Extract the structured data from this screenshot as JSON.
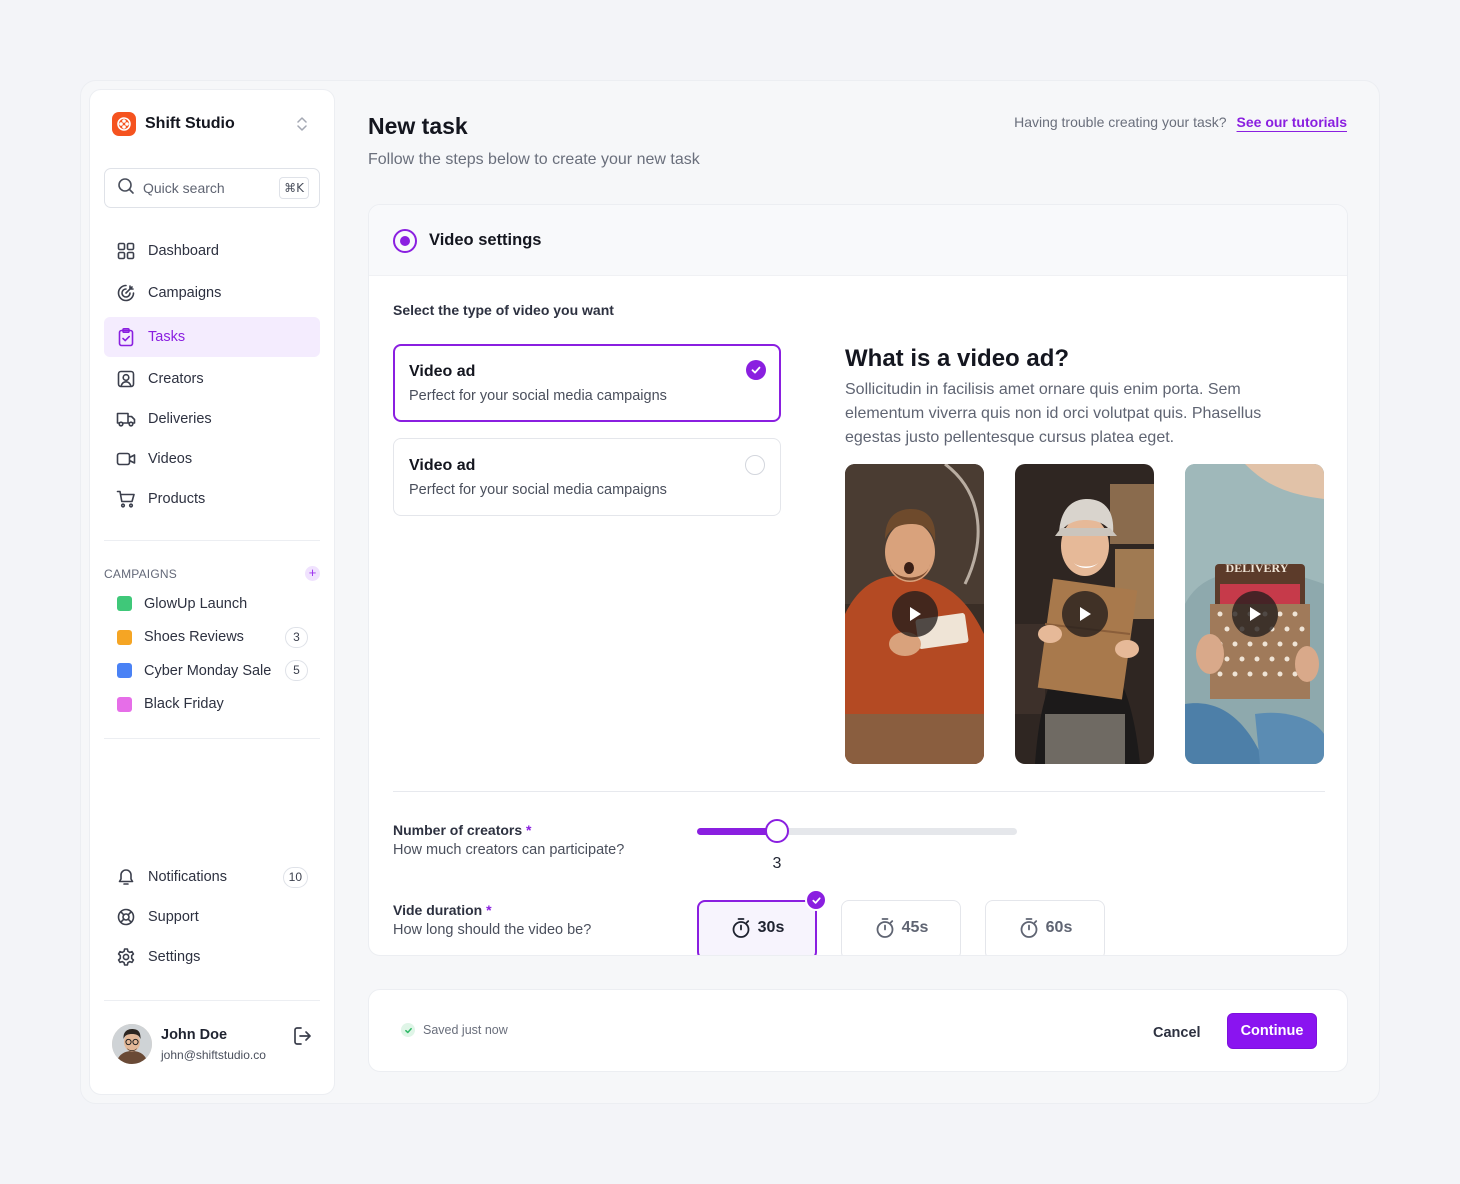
{
  "sidebar": {
    "brand": "Shift Studio",
    "search": {
      "placeholder": "Quick search",
      "shortcut": "⌘K"
    },
    "nav": [
      {
        "label": "Dashboard",
        "icon": "grid-icon"
      },
      {
        "label": "Campaigns",
        "icon": "target-icon"
      },
      {
        "label": "Tasks",
        "icon": "clipboard-check-icon",
        "active": true
      },
      {
        "label": "Creators",
        "icon": "user-square-icon"
      },
      {
        "label": "Deliveries",
        "icon": "truck-icon"
      },
      {
        "label": "Videos",
        "icon": "video-icon"
      },
      {
        "label": "Products",
        "icon": "cart-icon"
      }
    ],
    "campaigns_title": "CAMPAIGNS",
    "campaigns": [
      {
        "name": "GlowUp Launch",
        "color": "#3fc879",
        "count": null
      },
      {
        "name": "Shoes Reviews",
        "color": "#f5a524",
        "count": "3"
      },
      {
        "name": "Cyber Monday Sale",
        "color": "#4a82f5",
        "count": "5"
      },
      {
        "name": "Black Friday",
        "color": "#e66ee8",
        "count": null
      }
    ],
    "bottom_nav": [
      {
        "label": "Notifications",
        "icon": "bell-icon",
        "count": "10"
      },
      {
        "label": "Support",
        "icon": "lifebuoy-icon"
      },
      {
        "label": "Settings",
        "icon": "gear-icon"
      }
    ],
    "user": {
      "name": "John Doe",
      "email": "john@shiftstudio.co"
    }
  },
  "header": {
    "title": "New task",
    "subtitle": "Follow the steps below to create your new task",
    "help_text": "Having trouble creating your task?",
    "help_link": "See our tutorials"
  },
  "video_settings": {
    "title": "Video settings",
    "select_label": "Select the type of video you want",
    "options": [
      {
        "title": "Video ad",
        "description": "Perfect for your social media campaigns",
        "selected": true
      },
      {
        "title": "Video ad",
        "description": "Perfect for your social media campaigns",
        "selected": false
      }
    ],
    "info_title": "What is a video ad?",
    "info_text": "Sollicitudin in facilisis amet ornare quis enim porta. Sem elementum viverra quis non id orci volutpat quis. Phasellus egestas justo pellentesque cursus platea eget.",
    "thumb_text": "DELIVERY",
    "creators": {
      "label": "Number of creators",
      "required_mark": "*",
      "help": "How much creators can participate?",
      "value": "3",
      "fill_fraction": 0.25
    },
    "duration": {
      "label": "Vide duration",
      "required_mark": "*",
      "help": "How long should the video be?",
      "options": [
        {
          "label": "30s",
          "selected": true
        },
        {
          "label": "45s",
          "selected": false
        },
        {
          "label": "60s",
          "selected": false
        }
      ]
    }
  },
  "footer": {
    "status": "Saved just now",
    "cancel": "Cancel",
    "continue": "Continue"
  },
  "colors": {
    "accent": "#8a1fe0",
    "brand": "#f5531f"
  }
}
